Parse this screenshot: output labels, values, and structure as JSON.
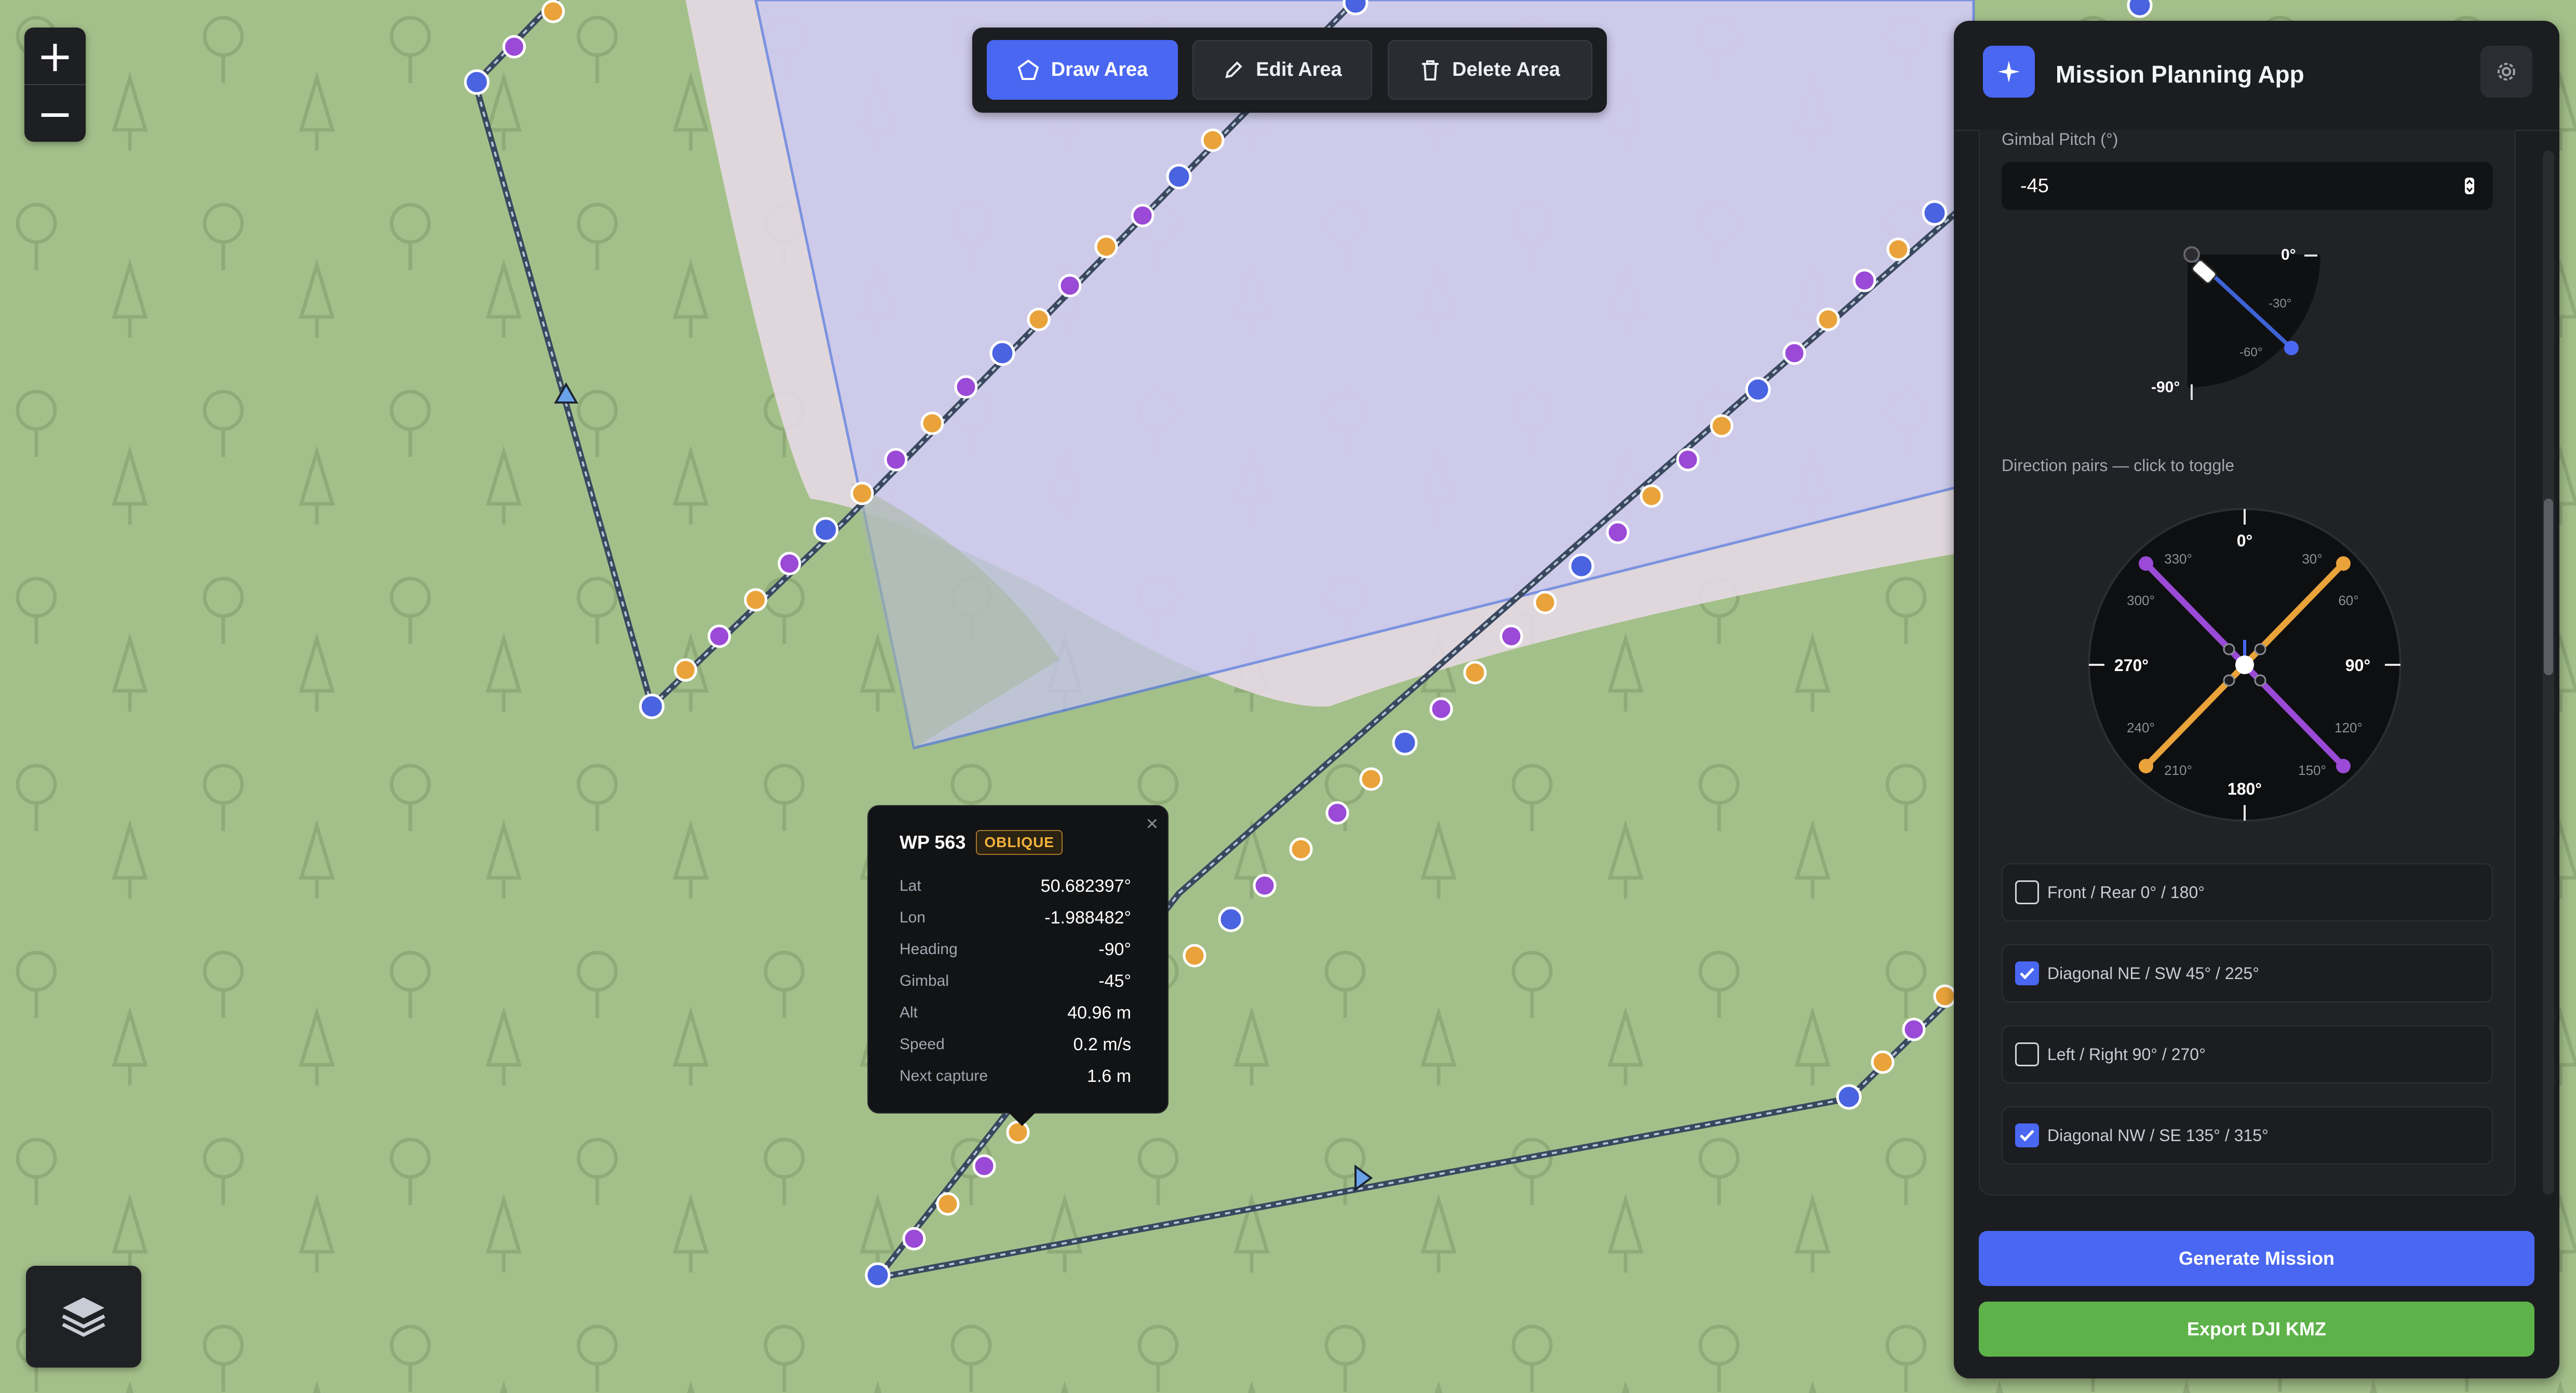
{
  "toolbar": {
    "draw_label": "Draw Area",
    "edit_label": "Edit Area",
    "delete_label": "Delete Area"
  },
  "map": {
    "zoom_in": "+",
    "zoom_out": "−"
  },
  "popup": {
    "title": "WP 563",
    "badge": "OBLIQUE",
    "close": "×",
    "rows": [
      {
        "key": "Lat",
        "value": "50.682397°"
      },
      {
        "key": "Lon",
        "value": "-1.988482°"
      },
      {
        "key": "Heading",
        "value": "-90°"
      },
      {
        "key": "Gimbal",
        "value": "-45°"
      },
      {
        "key": "Alt",
        "value": "40.96 m"
      },
      {
        "key": "Speed",
        "value": "0.2 m/s"
      },
      {
        "key": "Next capture",
        "value": "1.6 m"
      }
    ]
  },
  "panel": {
    "title": "Mission Planning App",
    "gimbal_label": "Gimbal Pitch (°)",
    "gimbal_value": "-45",
    "pitch_gauge": {
      "zero": "0°",
      "m30": "-30°",
      "m60": "-60°",
      "m90": "-90°"
    },
    "direction_label": "Direction pairs — click to toggle",
    "compass": {
      "n": "0°",
      "e": "90°",
      "s": "180°",
      "w": "270°",
      "d30": "30°",
      "d60": "60°",
      "d120": "120°",
      "d150": "150°",
      "d210": "210°",
      "d240": "240°",
      "d300": "300°",
      "d330": "330°"
    },
    "pairs": [
      {
        "label": "Front / Rear 0° / 180°",
        "checked": false
      },
      {
        "label": "Diagonal NE / SW 45° / 225°",
        "checked": true
      },
      {
        "label": "Left / Right 90° / 270°",
        "checked": false
      },
      {
        "label": "Diagonal NW / SE 135° / 315°",
        "checked": true
      }
    ],
    "generate_label": "Generate Mission",
    "export_label": "Export DJI KMZ"
  },
  "colors": {
    "accent": "#4a67f2",
    "export": "#5eb24a",
    "waypoint_blue": "#4a63e0",
    "waypoint_purple": "#9a4ad6",
    "waypoint_orange": "#e9a33a",
    "polygon": "#c9c6ef",
    "map_green": "#a4c08a"
  }
}
